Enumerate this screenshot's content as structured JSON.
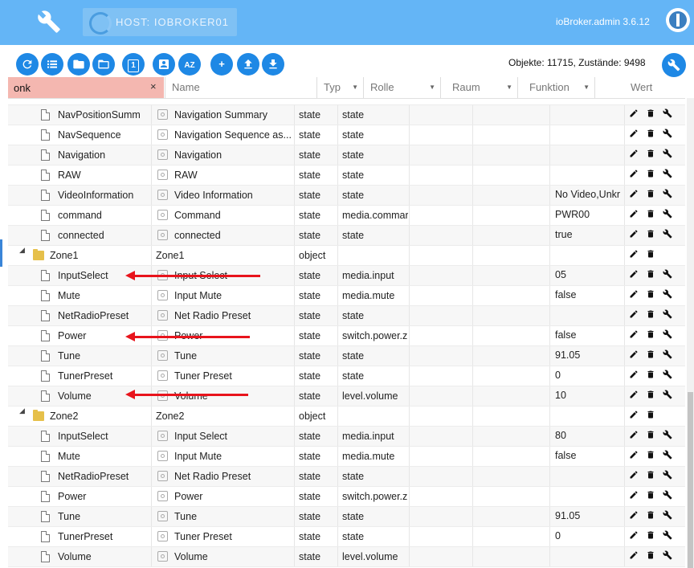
{
  "app": {
    "host_label": "HOST: IOBROKER01",
    "title": "ioBroker.admin 3.6.12"
  },
  "toolbar": {
    "buttons": [
      {
        "name": "refresh-button",
        "glyph": ""
      },
      {
        "name": "list-view-button",
        "glyph": ""
      },
      {
        "name": "folder-view-button",
        "glyph": ""
      },
      {
        "name": "folder-open-button",
        "glyph": ""
      },
      {
        "name": "one-button",
        "glyph": "1"
      },
      {
        "name": "user-button",
        "glyph": ""
      },
      {
        "name": "sort-az-button",
        "glyph": "AZ"
      },
      {
        "name": "add-button",
        "glyph": "+"
      },
      {
        "name": "upload-button",
        "glyph": ""
      },
      {
        "name": "download-button",
        "glyph": ""
      }
    ],
    "counts": "Objekte: 11715, Zustände: 9498"
  },
  "table": {
    "filter_value": "onk",
    "clear_glyph": "×",
    "headers": {
      "name": "Name",
      "type": "Typ",
      "role": "Rolle",
      "room": "Raum",
      "function": "Funktion",
      "value": "Wert"
    },
    "rows": [
      {
        "kind": "state",
        "id": "NavPositionSumm",
        "name": "Navigation Summary",
        "type": "state",
        "role": "state",
        "value": ""
      },
      {
        "kind": "state",
        "id": "NavSequence",
        "name": "Navigation Sequence as...",
        "type": "state",
        "role": "state",
        "value": ""
      },
      {
        "kind": "state",
        "id": "Navigation",
        "name": "Navigation",
        "type": "state",
        "role": "state",
        "value": ""
      },
      {
        "kind": "state",
        "id": "RAW",
        "name": "RAW",
        "type": "state",
        "role": "state",
        "value": ""
      },
      {
        "kind": "state",
        "id": "VideoInformation",
        "name": "Video Information",
        "type": "state",
        "role": "state",
        "value": "No Video,Unkr"
      },
      {
        "kind": "state",
        "id": "command",
        "name": "Command",
        "type": "state",
        "role": "media.commar",
        "value": "PWR00"
      },
      {
        "kind": "state",
        "id": "connected",
        "name": "connected",
        "type": "state",
        "role": "state",
        "value": "true"
      },
      {
        "kind": "folder",
        "id": "Zone1",
        "name": "Zone1",
        "type": "object",
        "role": "",
        "value": ""
      },
      {
        "kind": "state",
        "id": "InputSelect",
        "name": "Input Select",
        "type": "state",
        "role": "media.input",
        "value": "05"
      },
      {
        "kind": "state",
        "id": "Mute",
        "name": "Input Mute",
        "type": "state",
        "role": "media.mute",
        "value": "false"
      },
      {
        "kind": "state",
        "id": "NetRadioPreset",
        "name": "Net Radio Preset",
        "type": "state",
        "role": "state",
        "value": ""
      },
      {
        "kind": "state",
        "id": "Power",
        "name": "Power",
        "type": "state",
        "role": "switch.power.z",
        "value": "false"
      },
      {
        "kind": "state",
        "id": "Tune",
        "name": "Tune",
        "type": "state",
        "role": "state",
        "value": "91.05"
      },
      {
        "kind": "state",
        "id": "TunerPreset",
        "name": "Tuner Preset",
        "type": "state",
        "role": "state",
        "value": "0"
      },
      {
        "kind": "state",
        "id": "Volume",
        "name": "Volume",
        "type": "state",
        "role": "level.volume",
        "value": "10"
      },
      {
        "kind": "folder",
        "id": "Zone2",
        "name": "Zone2",
        "type": "object",
        "role": "",
        "value": ""
      },
      {
        "kind": "state",
        "id": "InputSelect",
        "name": "Input Select",
        "type": "state",
        "role": "media.input",
        "value": "80"
      },
      {
        "kind": "state",
        "id": "Mute",
        "name": "Input Mute",
        "type": "state",
        "role": "media.mute",
        "value": "false"
      },
      {
        "kind": "state",
        "id": "NetRadioPreset",
        "name": "Net Radio Preset",
        "type": "state",
        "role": "state",
        "value": ""
      },
      {
        "kind": "state",
        "id": "Power",
        "name": "Power",
        "type": "state",
        "role": "switch.power.z",
        "value": ""
      },
      {
        "kind": "state",
        "id": "Tune",
        "name": "Tune",
        "type": "state",
        "role": "state",
        "value": "91.05"
      },
      {
        "kind": "state",
        "id": "TunerPreset",
        "name": "Tuner Preset",
        "type": "state",
        "role": "state",
        "value": "0"
      },
      {
        "kind": "state",
        "id": "Volume",
        "name": "Volume",
        "type": "state",
        "role": "level.volume",
        "value": ""
      }
    ]
  },
  "colors": {
    "header_bar": "#64b5f6",
    "button": "#1e88e5",
    "filter_highlight": "#f4b7b0",
    "annotation_arrow": "#e8141c"
  }
}
